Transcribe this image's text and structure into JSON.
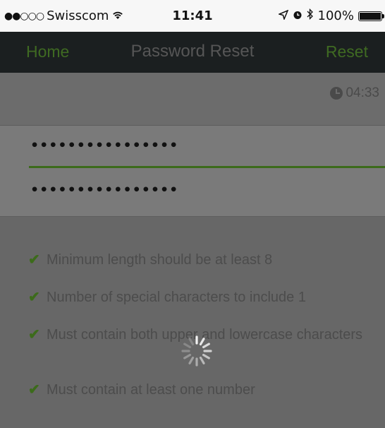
{
  "status_bar": {
    "signal": "●●○○○",
    "carrier": "Swisscom",
    "wifi_icon": "wifi-icon",
    "time": "11:41",
    "location_icon": "location-arrow-icon",
    "alarm_icon": "alarm-clock-icon",
    "bluetooth_icon": "bluetooth-icon",
    "battery": "100%"
  },
  "nav": {
    "home_label": "Home",
    "title": "Password Reset",
    "reset_label": "Reset"
  },
  "timer": {
    "icon": "clock-icon",
    "value": "04:33"
  },
  "fields": {
    "password": "••••••••••••••••",
    "confirm_password": "••••••••••••••••"
  },
  "rules": [
    {
      "text": "Minimum length should be at least 8"
    },
    {
      "text": "Number of special characters to include 1"
    },
    {
      "text": "Must contain both upper and lowercase characters"
    },
    {
      "text": "Must contain at least one number"
    }
  ],
  "colors": {
    "accent_green": "#3c6b1b",
    "nav_background": "#1b1f20",
    "overlay_gray": "#676767"
  },
  "loading_icon": "spinner-icon"
}
